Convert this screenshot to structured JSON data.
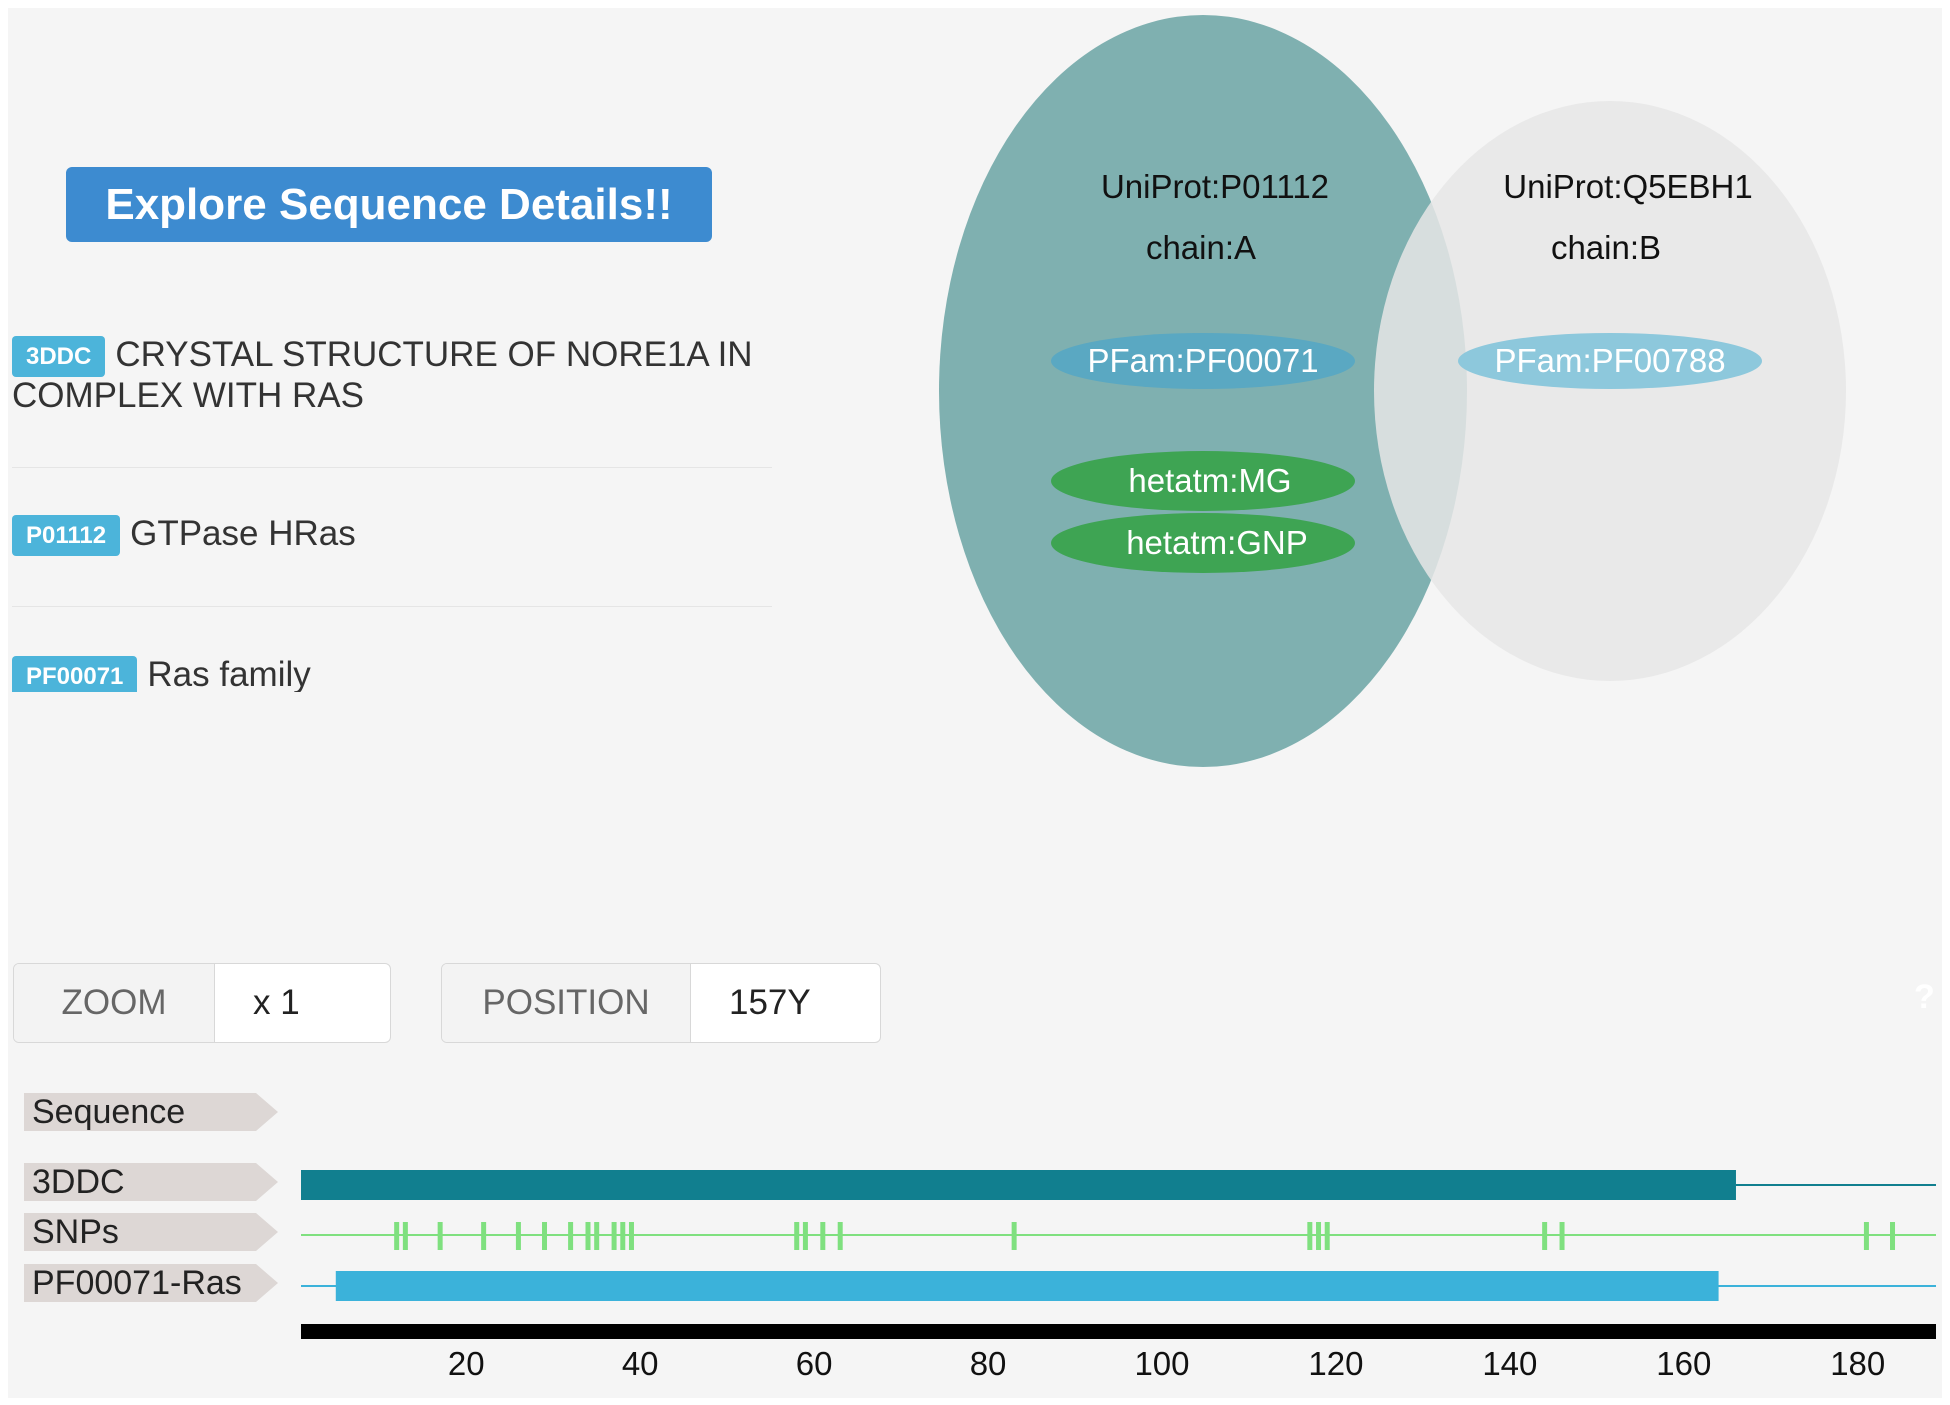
{
  "explore_button": {
    "label": "Explore Sequence Details!!"
  },
  "entries": [
    {
      "badge": "3DDC",
      "text": "CRYSTAL STRUCTURE OF NORE1A IN COMPLEX WITH RAS"
    },
    {
      "badge": "P01112",
      "text": "GTPase HRas"
    },
    {
      "badge": "PF00071",
      "text": "Ras family"
    }
  ],
  "venn": {
    "chain_a": {
      "uniprot": "UniProt:P01112",
      "chain": "chain:A",
      "pfam": "PFam:PF00071",
      "hetatms": [
        "hetatm:MG",
        "hetatm:GNP"
      ],
      "color": "#7fb0b0"
    },
    "chain_b": {
      "uniprot": "UniProt:Q5EBH1",
      "chain": "chain:B",
      "pfam": "PFam:PF00788",
      "color": "#e6e6e6"
    },
    "pfam_a_color": "#5aa8c2",
    "pfam_b_color": "#8dc8dc",
    "hetatm_color": "#3ea453"
  },
  "controls": {
    "zoom_label": "ZOOM",
    "zoom_value": "x 1",
    "position_label": "POSITION",
    "position_value": "157Y"
  },
  "help": "?",
  "feature_viewer": {
    "tracks": [
      "Sequence",
      "3DDC",
      "SNPs",
      "PF00071-Ras"
    ],
    "axis_min": 1,
    "axis_max": 189,
    "axis_ticks": [
      20,
      40,
      60,
      80,
      100,
      120,
      140,
      160,
      180
    ],
    "structure_range": [
      1,
      166
    ],
    "domain_range": [
      5,
      164
    ],
    "snp_positions": [
      12,
      13,
      17,
      22,
      26,
      29,
      32,
      34,
      35,
      37,
      38,
      39,
      58,
      59,
      61,
      63,
      83,
      117,
      118,
      119,
      144,
      146,
      181,
      184
    ],
    "colors": {
      "structure": "#117f8f",
      "structure_line": "#117f8f",
      "snp": "#7fe07f",
      "domain": "#3bb2da",
      "domain_line": "#3bb2da",
      "axis": "#000000"
    }
  }
}
